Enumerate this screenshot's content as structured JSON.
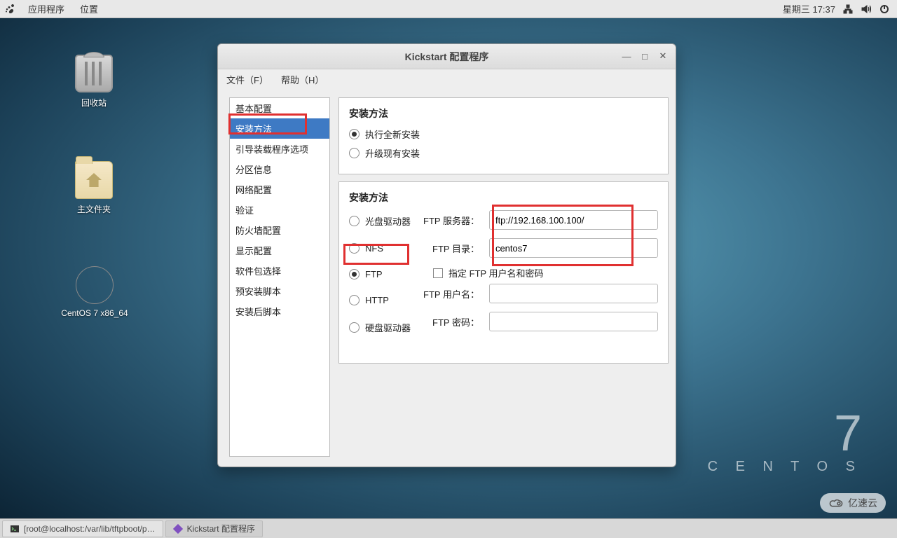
{
  "panel": {
    "apps": "应用程序",
    "places": "位置",
    "datetime": "星期三 17:37"
  },
  "desktop": {
    "trash": "回收站",
    "home": "主文件夹",
    "disc": "CentOS 7 x86_64"
  },
  "brand": {
    "seven": "7",
    "name": "C E N T O S"
  },
  "window": {
    "title": "Kickstart 配置程序",
    "menu_file": "文件（F）",
    "menu_help": "帮助（H）",
    "sidebar": [
      "基本配置",
      "安装方法",
      "引导装载程序选项",
      "分区信息",
      "网络配置",
      "验证",
      "防火墙配置",
      "显示配置",
      "软件包选择",
      "预安装脚本",
      "安装后脚本"
    ],
    "section1_title": "安装方法",
    "opt_fresh": "执行全新安装",
    "opt_upgrade": "升级现有安装",
    "section2_title": "安装方法",
    "src_cdrom": "光盘驱动器",
    "src_nfs": "NFS",
    "src_ftp": "FTP",
    "src_http": "HTTP",
    "src_hdd": "硬盘驱动器",
    "lbl_ftp_server": "FTP 服务器：",
    "lbl_ftp_dir": "FTP 目录：",
    "val_ftp_server": "ftp://192.168.100.100/",
    "val_ftp_dir": "centos7",
    "chk_creds": "指定  FTP 用户名和密码",
    "lbl_user": "FTP 用户名：",
    "lbl_pass": "FTP 密码："
  },
  "taskbar": {
    "term": "[root@localhost:/var/lib/tftpboot/p…",
    "kick": "Kickstart 配置程序"
  },
  "watermark": "亿速云"
}
